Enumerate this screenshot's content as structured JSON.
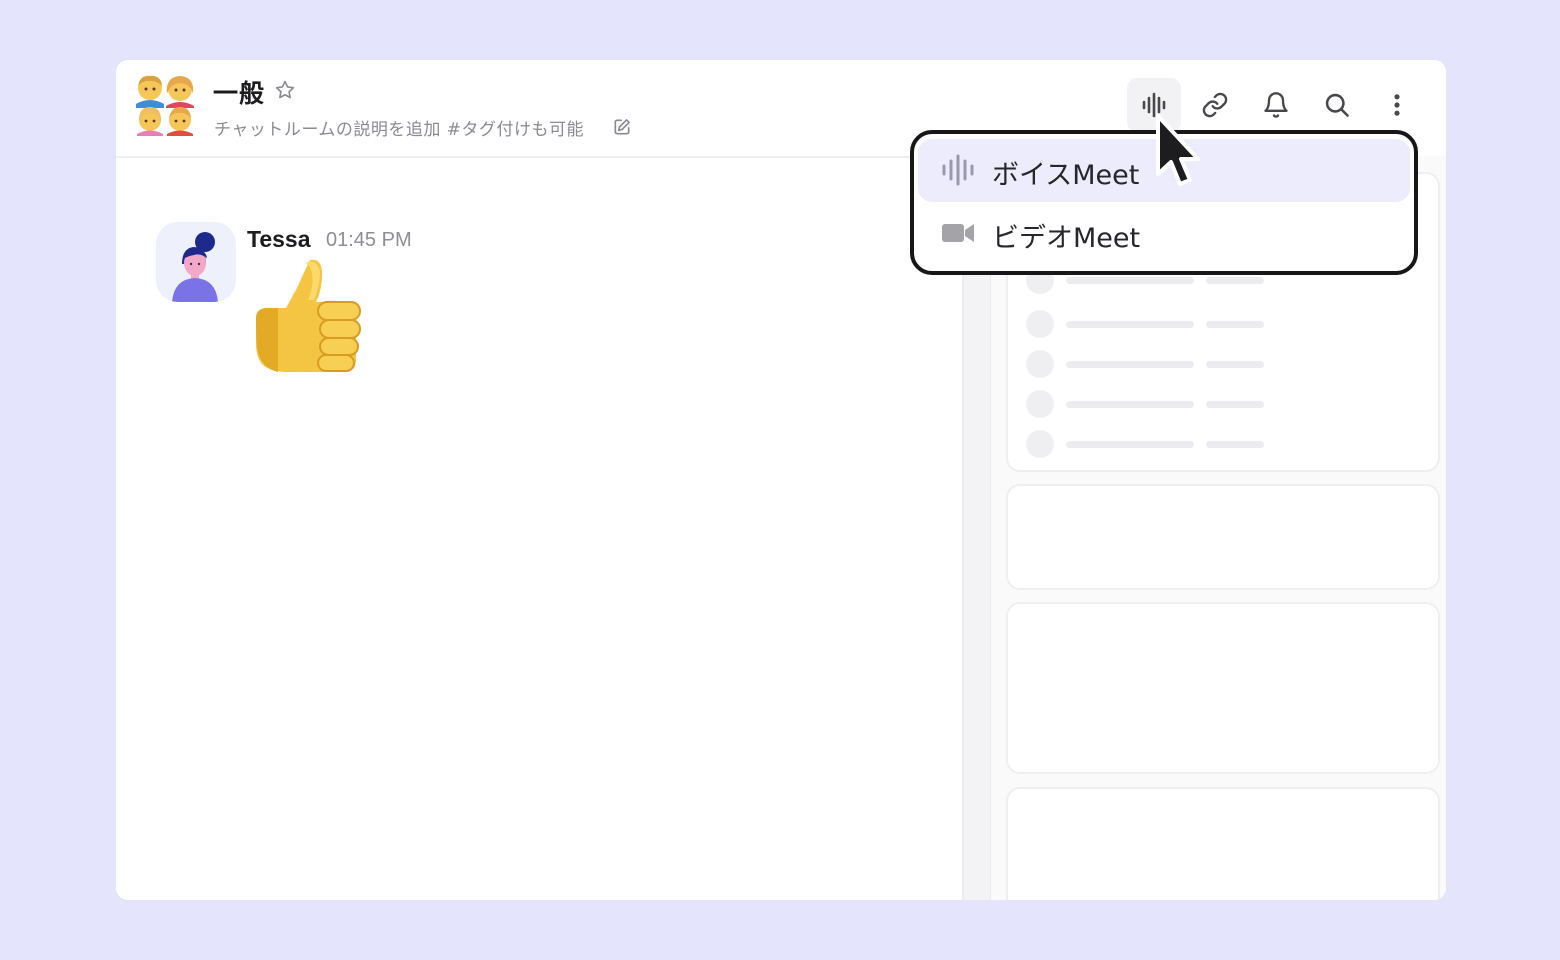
{
  "room": {
    "title": "一般",
    "description": "チャットルームの説明を追加 #タグ付けも可能"
  },
  "header_actions": [
    "voice-meet-icon",
    "link-icon",
    "bell-icon",
    "search-icon",
    "more-icon"
  ],
  "message": {
    "sender": "Tessa",
    "time": "01:45 PM",
    "content_emoji": "thumbs-up"
  },
  "meet_menu": {
    "items": [
      {
        "label": "ボイスMeet",
        "icon": "audio-wave-icon",
        "highlighted": true
      },
      {
        "label": "ビデオMeet",
        "icon": "video-camera-icon",
        "highlighted": false
      }
    ]
  },
  "colors": {
    "background": "#e4e4fc",
    "menu_highlight": "#ececfc",
    "menu_border": "#17171a"
  }
}
